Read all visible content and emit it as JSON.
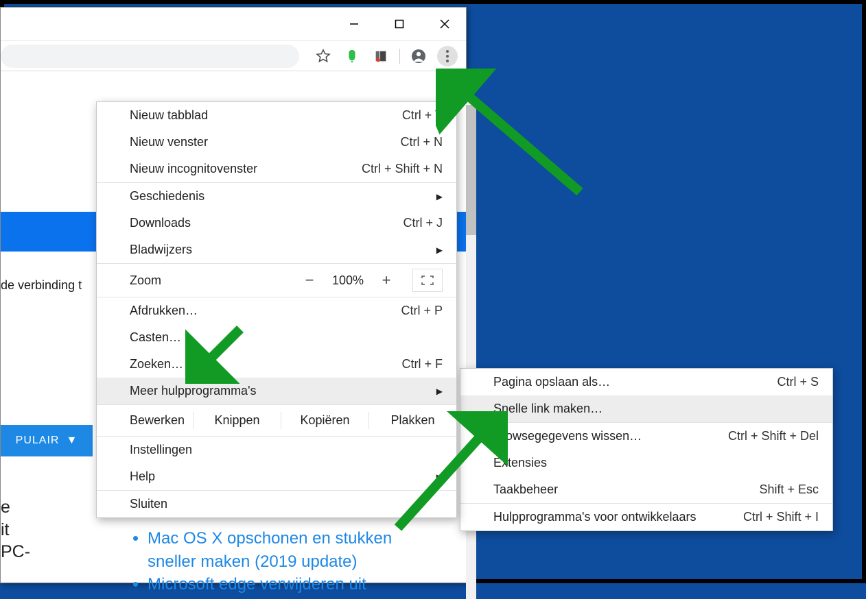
{
  "toolbar": {
    "extensions": [
      "evernote",
      "office"
    ]
  },
  "page": {
    "conn_text": "de verbinding t",
    "populair_label": "PULAIR",
    "side_lines": [
      "e",
      "it",
      " PC-"
    ],
    "bullet1_line1": "Mac OS X opschonen en stukken",
    "bullet1_line2": "sneller maken (2019 update)",
    "bullet2": "Microsoft edge verwijderen uit"
  },
  "menu": {
    "new_tab": {
      "label": "Nieuw tabblad",
      "shortcut": "Ctrl + T"
    },
    "new_window": {
      "label": "Nieuw venster",
      "shortcut": "Ctrl + N"
    },
    "new_incognito": {
      "label": "Nieuw incognitovenster",
      "shortcut": "Ctrl + Shift + N"
    },
    "history": {
      "label": "Geschiedenis"
    },
    "downloads": {
      "label": "Downloads",
      "shortcut": "Ctrl + J"
    },
    "bookmarks": {
      "label": "Bladwijzers"
    },
    "zoom": {
      "label": "Zoom",
      "value": "100%"
    },
    "print": {
      "label": "Afdrukken…",
      "shortcut": "Ctrl + P"
    },
    "cast": {
      "label": "Casten…"
    },
    "find": {
      "label": "Zoeken…",
      "shortcut": "Ctrl + F"
    },
    "more_tools": {
      "label": "Meer hulpprogramma's"
    },
    "edit": {
      "label": "Bewerken",
      "cut": "Knippen",
      "copy": "Kopiëren",
      "paste": "Plakken"
    },
    "settings": {
      "label": "Instellingen"
    },
    "help": {
      "label": "Help"
    },
    "close": {
      "label": "Sluiten"
    }
  },
  "submenu": {
    "save_as": {
      "label": "Pagina opslaan als…",
      "shortcut": "Ctrl + S"
    },
    "create_shortcut": {
      "label": "Snelle link maken…"
    },
    "clear_data": {
      "label": "Browsegegevens wissen…",
      "shortcut": "Ctrl + Shift + Del"
    },
    "extensions": {
      "label": "Extensies"
    },
    "task_manager": {
      "label": "Taakbeheer",
      "shortcut": "Shift + Esc"
    },
    "dev_tools": {
      "label": "Hulpprogramma's voor ontwikkelaars",
      "shortcut": "Ctrl + Shift + I"
    }
  }
}
